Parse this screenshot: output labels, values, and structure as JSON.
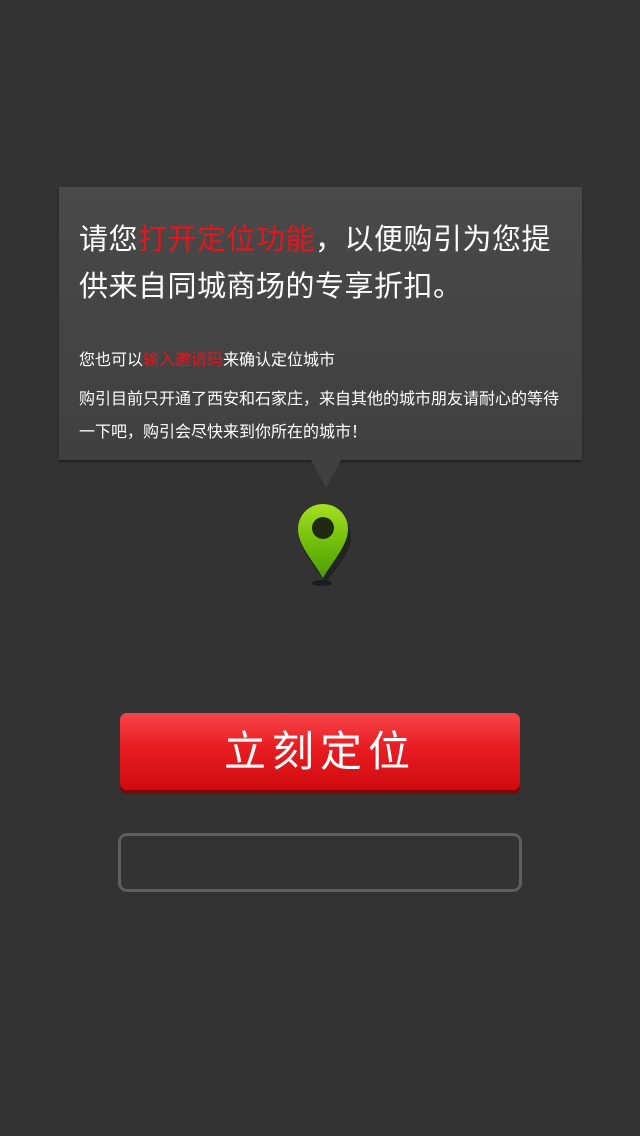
{
  "tooltip": {
    "headline_part1": "请您",
    "headline_highlight": "打开定位功能",
    "headline_part2": "，以便购引为您提供来自同城商场的专享折扣。",
    "line1_part1": "您也可以",
    "line1_link": "输入邀请码",
    "line1_part2": "来确认定位城市",
    "line2": "购引目前只开通了西安和石家庄，来自其他的城市朋友请耐心的等待一下吧，购引会尽快来到你所在的城市！"
  },
  "map_pin": {
    "icon": "map-pin-icon"
  },
  "locate_button": {
    "label": "立刻定位"
  },
  "invite_input": {
    "value": "",
    "placeholder": ""
  },
  "colors": {
    "background": "#333333",
    "accent_red": "#e8141b",
    "pin_green": "#7ecb0a"
  }
}
